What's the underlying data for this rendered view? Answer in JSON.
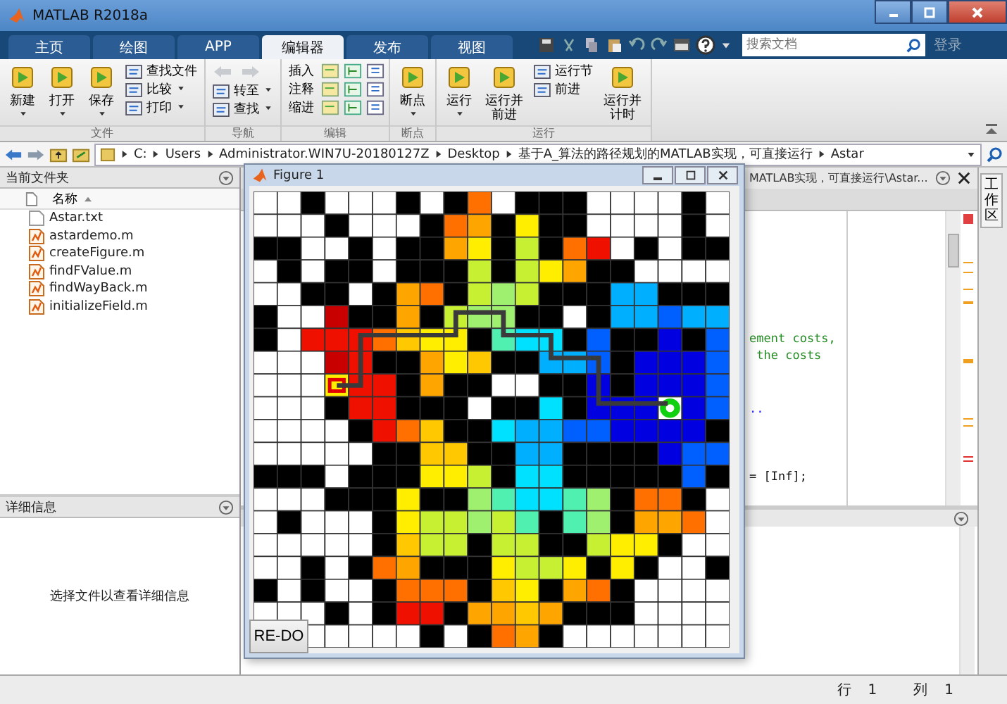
{
  "window": {
    "title": "MATLAB R2018a"
  },
  "tabs": [
    {
      "label": "主页",
      "selected": false
    },
    {
      "label": "绘图",
      "selected": false
    },
    {
      "label": "APP",
      "selected": false
    },
    {
      "label": "编辑器",
      "selected": true
    },
    {
      "label": "发布",
      "selected": false
    },
    {
      "label": "视图",
      "selected": false
    }
  ],
  "search": {
    "placeholder": "搜索文档"
  },
  "login": "登录",
  "ribbon": [
    {
      "label": "文件",
      "items": [
        {
          "kind": "large",
          "label": "新建",
          "caret": true
        },
        {
          "kind": "large",
          "label": "打开",
          "caret": true
        },
        {
          "kind": "large",
          "label": "保存",
          "caret": true
        },
        {
          "kind": "small",
          "label": "查找文件",
          "caret": false
        },
        {
          "kind": "small",
          "label": "比较",
          "caret": true
        },
        {
          "kind": "small",
          "label": "打印",
          "caret": true
        }
      ]
    },
    {
      "label": "导航",
      "items": [
        {
          "kind": "arrows",
          "disabled": true
        },
        {
          "kind": "small",
          "label": "转至",
          "caret": true
        },
        {
          "kind": "small",
          "label": "查找",
          "caret": true
        }
      ]
    },
    {
      "label": "编辑",
      "items": [
        {
          "kind": "tools",
          "label": "插入"
        },
        {
          "kind": "tools",
          "label": "注释"
        },
        {
          "kind": "tools",
          "label": "缩进"
        }
      ]
    },
    {
      "label": "断点",
      "items": [
        {
          "kind": "large",
          "label": "断点",
          "caret": true
        }
      ]
    },
    {
      "label": "运行",
      "items": [
        {
          "kind": "large",
          "label": "运行",
          "caret": true
        },
        {
          "kind": "large",
          "label": "运行并前进",
          "caret": false
        },
        {
          "kind": "small",
          "label": "运行节",
          "caret": false
        },
        {
          "kind": "small",
          "label": "前进",
          "caret": false
        },
        {
          "kind": "large",
          "label": "运行并计时",
          "caret": false
        }
      ]
    }
  ],
  "path": [
    "C:",
    "Users",
    "Administrator.WIN7U-20180127Z",
    "Desktop",
    "基于A_算法的路径规划的MATLAB实现，可直接运行",
    "Astar"
  ],
  "current_folder": {
    "title": "当前文件夹",
    "column": "名称",
    "files": [
      {
        "name": "Astar.txt",
        "kind": "txt"
      },
      {
        "name": "astardemo.m",
        "kind": "m"
      },
      {
        "name": "createFigure.m",
        "kind": "m"
      },
      {
        "name": "findFValue.m",
        "kind": "m"
      },
      {
        "name": "findWayBack.m",
        "kind": "m"
      },
      {
        "name": "initializeField.m",
        "kind": "m"
      }
    ]
  },
  "details": {
    "title": "详细信息",
    "message": "选择文件以查看详细信息"
  },
  "editor": {
    "title": "MATLAB实现，可直接运行\\Astar...",
    "lines": [
      {
        "text": "ement costs,",
        "kind": "comment"
      },
      {
        "text": " the costs",
        "kind": "comment"
      },
      {
        "text": "..",
        "kind": "continuation"
      },
      {
        "text": "= [Inf];",
        "kind": "code"
      }
    ]
  },
  "workspace_tab": "工作区",
  "figure": {
    "title": "Figure 1",
    "button": "RE-DO"
  },
  "status_bar": [
    {
      "label": "行",
      "value": "1"
    },
    {
      "label": "列",
      "value": "1"
    }
  ]
}
